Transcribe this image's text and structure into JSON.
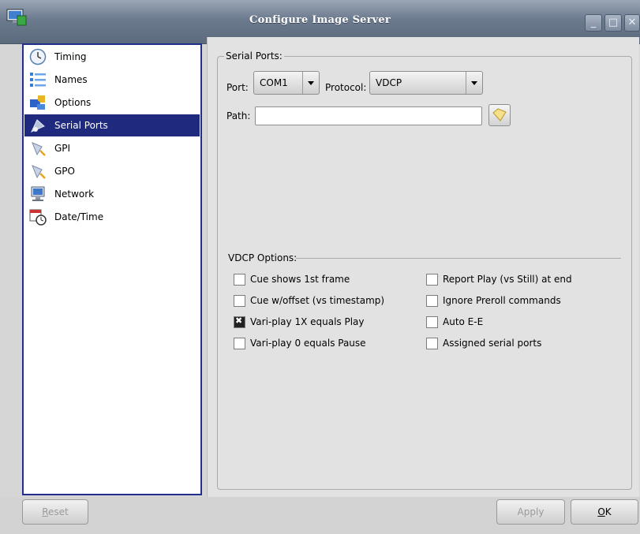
{
  "window": {
    "title": "Configure Image Server"
  },
  "titlebar_buttons": {
    "minimize": "_",
    "maximize": "□",
    "close": "✕"
  },
  "sidebar": {
    "items": [
      {
        "label": "Timing",
        "icon": "clock-icon"
      },
      {
        "label": "Names",
        "icon": "list-icon"
      },
      {
        "label": "Options",
        "icon": "puzzle-icon"
      },
      {
        "label": "Serial Ports",
        "icon": "serial-ports-icon",
        "selected": true
      },
      {
        "label": "GPI",
        "icon": "gpi-icon"
      },
      {
        "label": "GPO",
        "icon": "gpo-icon"
      },
      {
        "label": "Network",
        "icon": "network-icon"
      },
      {
        "label": "Date/Time",
        "icon": "calendar-clock-icon"
      }
    ]
  },
  "serial_ports": {
    "legend": "Serial Ports:",
    "port_label": "Port:",
    "port_value": "COM1",
    "protocol_label": "Protocol:",
    "protocol_value": "VDCP",
    "path_label": "Path:",
    "path_value": ""
  },
  "vdcp_options": {
    "legend": "VDCP Options:",
    "left": [
      {
        "label": "Cue shows 1st frame",
        "checked": false
      },
      {
        "label": "Cue w/offset (vs timestamp)",
        "checked": false
      },
      {
        "label": "Vari-play 1X equals Play",
        "checked": true
      },
      {
        "label": "Vari-play 0 equals Pause",
        "checked": false
      }
    ],
    "right": [
      {
        "label": "Report Play (vs Still) at end",
        "checked": false
      },
      {
        "label": "Ignore Preroll commands",
        "checked": false
      },
      {
        "label": "Auto E-E",
        "checked": false
      },
      {
        "label": "Assigned serial ports",
        "checked": false
      }
    ]
  },
  "buttons": {
    "reset": {
      "mnemonic": "R",
      "rest": "eset"
    },
    "apply": {
      "label": "Apply"
    },
    "ok": {
      "mnemonic": "O",
      "rest": "K"
    }
  },
  "colors": {
    "selection": "#1f2a7f",
    "titlebar": "#6c7a8e"
  }
}
